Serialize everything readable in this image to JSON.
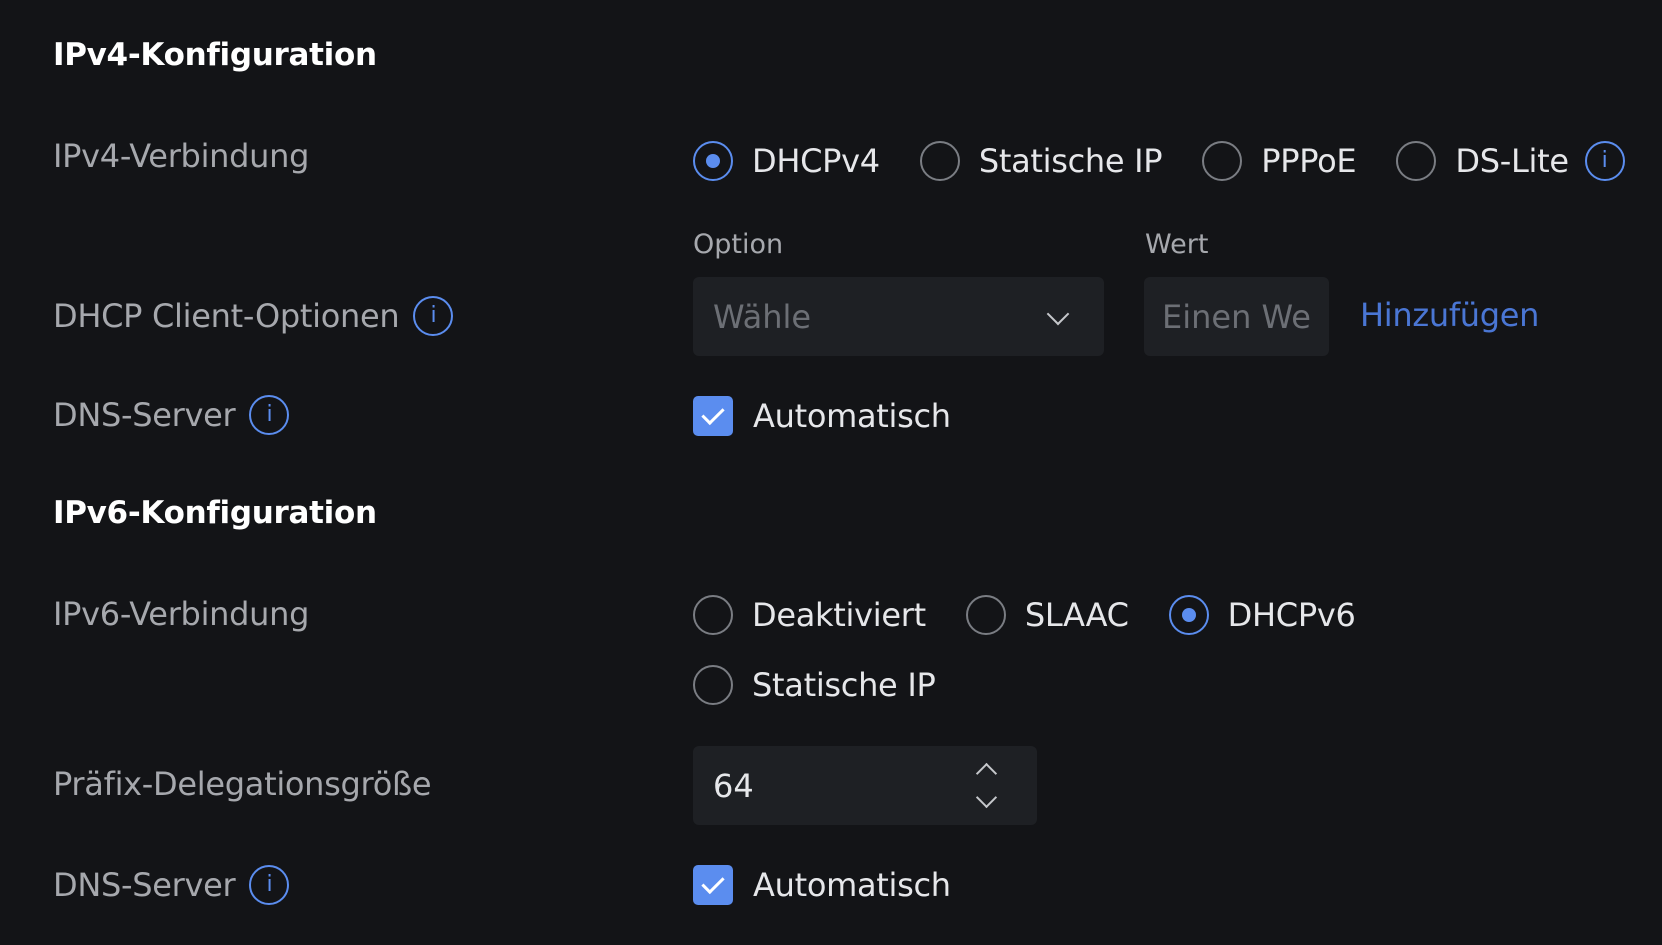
{
  "ipv4": {
    "heading": "IPv4-Konfiguration",
    "connection_label": "IPv4-Verbindung",
    "connection_options": [
      "DHCPv4",
      "Statische IP",
      "PPPoE",
      "DS-Lite"
    ],
    "connection_selected": "DHCPv4",
    "dhcp_options": {
      "label": "DHCP Client-Optionen",
      "option_header": "Option",
      "value_header": "Wert",
      "select_placeholder": "Wähle",
      "value_placeholder": "Einen Wert",
      "add_label": "Hinzufügen"
    },
    "dns": {
      "label": "DNS-Server",
      "auto_label": "Automatisch",
      "auto_checked": true
    }
  },
  "ipv6": {
    "heading": "IPv6-Konfiguration",
    "connection_label": "IPv6-Verbindung",
    "connection_options": [
      "Deaktiviert",
      "SLAAC",
      "DHCPv6",
      "Statische IP"
    ],
    "connection_selected": "DHCPv6",
    "prefix": {
      "label": "Präfix-Delegationsgröße",
      "value": "64"
    },
    "dns": {
      "label": "DNS-Server",
      "auto_label": "Automatisch",
      "auto_checked": true
    }
  },
  "icons": {
    "info": "i",
    "info_icon_name": "info-icon",
    "chevron_icon_name": "chevron-down-icon",
    "check_icon_name": "check-icon"
  },
  "colors": {
    "background": "#131417",
    "accent": "#5b8def",
    "link": "#4a76d4",
    "field_bg": "#1e2024",
    "label": "#a6a8ad",
    "text": "#e6e7ea"
  }
}
